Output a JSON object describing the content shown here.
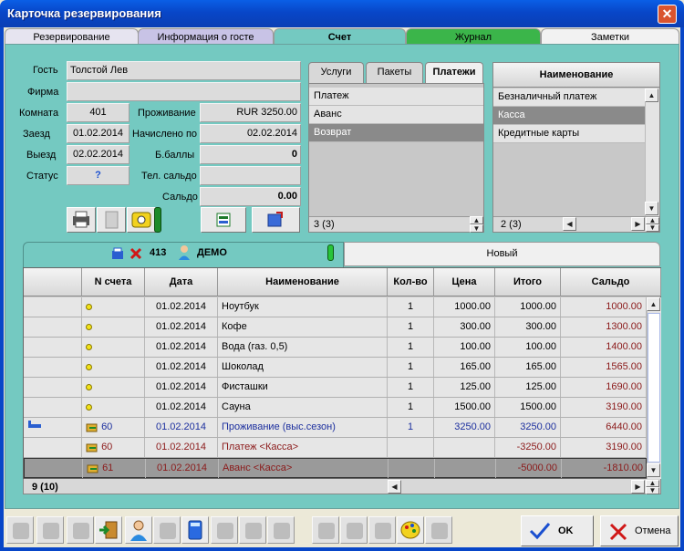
{
  "window": {
    "title": "Карточка резервирования",
    "close": "✕"
  },
  "tabs": [
    "Резервирование",
    "Информация о госте",
    "Счет",
    "Журнал",
    "Заметки"
  ],
  "guest": {
    "name_label": "Гость",
    "name": "Толстой Лев",
    "firm_label": "Фирма",
    "firm": "",
    "room_label": "Комната",
    "room": "401",
    "arrival_label": "Заезд",
    "arrival": "01.02.2014",
    "departure_label": "Выезд",
    "departure": "02.02.2014",
    "status_label": "Статус",
    "status": "?",
    "stay_label": "Проживание",
    "stay": "RUR 3250.00",
    "charged_label": "Начислено по",
    "charged": "02.02.2014",
    "bonus_label": "Б.баллы",
    "bonus": "0",
    "phone_label": "Тел. сальдо",
    "phone": "",
    "saldo_label": "Сальдо",
    "saldo": "0.00"
  },
  "paytabs": [
    "Услуги",
    "Пакеты",
    "Платежи"
  ],
  "paylist": {
    "items": [
      "Платеж",
      "Аванс",
      "Возврат"
    ],
    "count": "3 (3)"
  },
  "names": {
    "header": "Наименование",
    "items": [
      "Безналичный платеж",
      "Касса",
      "Кредитные карты"
    ],
    "count": "2 (3)"
  },
  "account": {
    "number": "413",
    "name": "ДЕМО",
    "new_tab": "Новый"
  },
  "grid": {
    "headers": [
      "",
      "N счета",
      "Дата",
      "Наименование",
      "Кол-во",
      "Цена",
      "Итого",
      "Сальдо"
    ],
    "rows": [
      {
        "n": "",
        "date": "01.02.2014",
        "name": "Ноутбук",
        "qty": "1",
        "price": "1000.00",
        "total": "1000.00",
        "saldo": "1000.00"
      },
      {
        "n": "",
        "date": "01.02.2014",
        "name": "Кофе",
        "qty": "1",
        "price": "300.00",
        "total": "300.00",
        "saldo": "1300.00"
      },
      {
        "n": "",
        "date": "01.02.2014",
        "name": "Вода (газ. 0,5)",
        "qty": "1",
        "price": "100.00",
        "total": "100.00",
        "saldo": "1400.00"
      },
      {
        "n": "",
        "date": "01.02.2014",
        "name": "Шоколад",
        "qty": "1",
        "price": "165.00",
        "total": "165.00",
        "saldo": "1565.00"
      },
      {
        "n": "",
        "date": "01.02.2014",
        "name": "Фисташки",
        "qty": "1",
        "price": "125.00",
        "total": "125.00",
        "saldo": "1690.00"
      },
      {
        "n": "",
        "date": "01.02.2014",
        "name": "Сауна",
        "qty": "1",
        "price": "1500.00",
        "total": "1500.00",
        "saldo": "3190.00"
      },
      {
        "n": "60",
        "date": "01.02.2014",
        "name": "Проживание (выс.сезон)",
        "qty": "1",
        "price": "3250.00",
        "total": "3250.00",
        "saldo": "6440.00"
      },
      {
        "n": "60",
        "date": "01.02.2014",
        "name": "Платеж <Касса>",
        "qty": "",
        "price": "",
        "total": "-3250.00",
        "saldo": "3190.00"
      },
      {
        "n": "61",
        "date": "01.02.2014",
        "name": "Аванс <Касса>",
        "qty": "",
        "price": "",
        "total": "-5000.00",
        "saldo": "-1810.00"
      }
    ],
    "count": "9 (10)"
  },
  "buttons": {
    "ok": "OK",
    "cancel": "Отмена"
  },
  "colors": {
    "accent": "#0846c8",
    "teal": "#74c9c1",
    "blue_text": "#1c2f9e",
    "red_text": "#8b1a1a"
  }
}
